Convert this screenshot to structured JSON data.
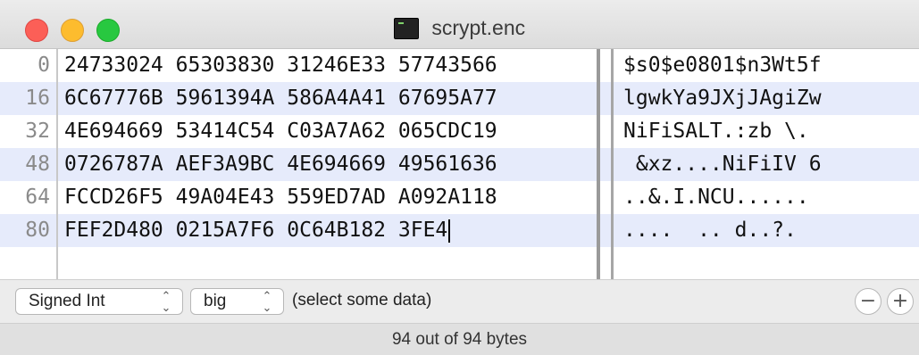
{
  "window": {
    "title": "scrypt.enc"
  },
  "hex_rows": [
    {
      "offset": "0",
      "hex": "24733024 65303830 31246E33 57743566",
      "ascii": "$s0$e0801$n3Wt5f"
    },
    {
      "offset": "16",
      "hex": "6C67776B 5961394A 586A4A41 67695A77",
      "ascii": "lgwkYa9JXjJAgiZw"
    },
    {
      "offset": "32",
      "hex": "4E694669 53414C54 C03A7A62 065CDC19",
      "ascii": "NiFiSALT.:zb \\."
    },
    {
      "offset": "48",
      "hex": "0726787A AEF3A9BC 4E694669 49561636",
      "ascii": " &xz....NiFiIV 6"
    },
    {
      "offset": "64",
      "hex": "FCCD26F5 49A04E43 559ED7AD A092A118",
      "ascii": "..&.I.NCU......"
    },
    {
      "offset": "80",
      "hex": "FEF2D480 0215A7F6 0C64B182 3FE4",
      "ascii": "....  .. d..?."
    }
  ],
  "toolbar": {
    "type_select": "Signed Int",
    "endian_select": "big",
    "selection_status": "(select some data)",
    "minus_label": "−",
    "plus_label": "+"
  },
  "status": {
    "text": "94 out of 94 bytes"
  },
  "colors": {
    "row_highlight": "#e6ebfb",
    "close": "#fc5f57",
    "minimize": "#fdbc2e",
    "zoom": "#28c840"
  }
}
